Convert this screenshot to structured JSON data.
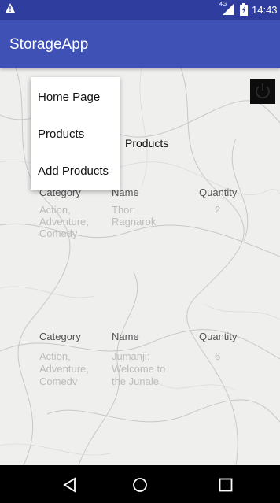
{
  "status_bar": {
    "time": "14:43",
    "network": "4G",
    "icons": [
      "warning-icon",
      "signal-icon",
      "battery-icon"
    ]
  },
  "app_bar": {
    "title": "StorageApp",
    "color": "#3f51b5"
  },
  "popup_menu": {
    "items": [
      "Home Page",
      "Products",
      "Add Products"
    ]
  },
  "page": {
    "heading": "Products",
    "power_icon": "power-icon"
  },
  "products": {
    "headers": {
      "category": "Category",
      "name": "Name",
      "quantity": "Quantity"
    },
    "rows": [
      {
        "category_lines": [
          "Action,",
          "Adventure,",
          "Comedy"
        ],
        "name_lines": [
          "Thor:",
          "Ragnarok"
        ],
        "quantity": "2"
      },
      {
        "category_lines": [
          "Action,",
          "Adventure,",
          "Comedv"
        ],
        "name_lines": [
          "Jumanji:",
          "Welcome to",
          "the Junale"
        ],
        "quantity": "6"
      }
    ]
  },
  "nav_bar": {
    "icons": [
      "back-icon",
      "home-icon",
      "recents-icon"
    ]
  }
}
